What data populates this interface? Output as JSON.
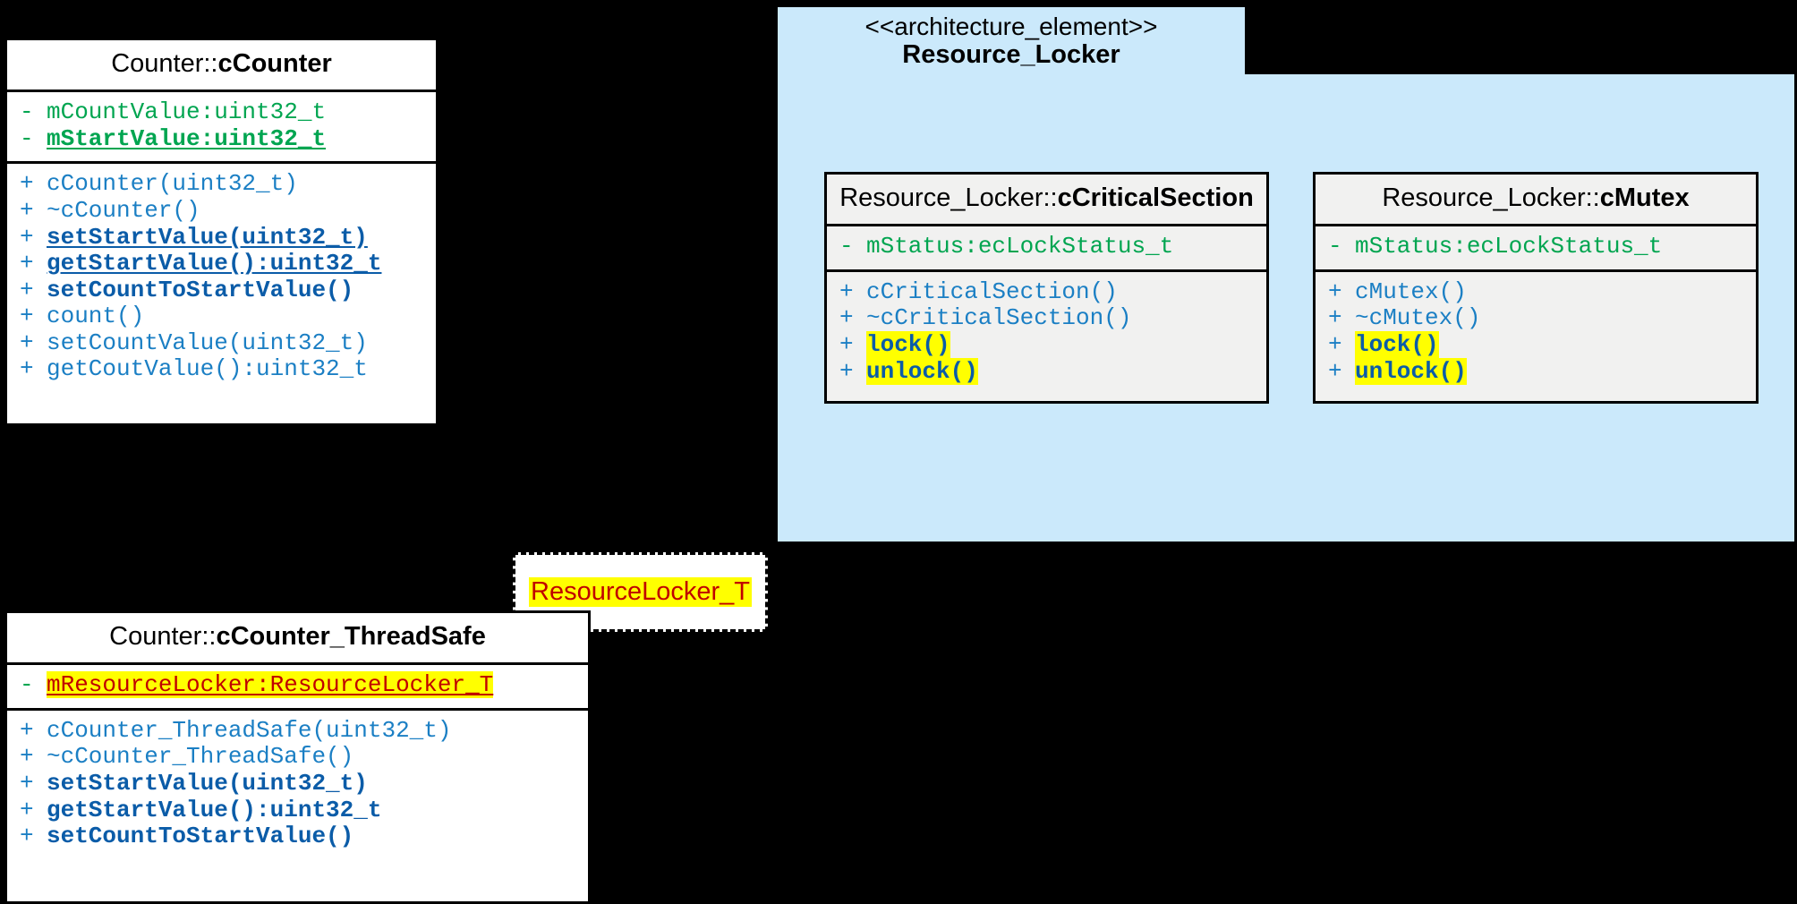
{
  "diagram": {
    "type": "uml-class-diagram",
    "background": "#000000",
    "colors": {
      "package_fill": "#cbe9fb",
      "class_fill_white": "#ffffff",
      "class_fill_gray": "#f1f1f0",
      "attribute_green": "#00a550",
      "method_blue": "#1b7fc4",
      "method_bold_blue": "#0b5ca8",
      "highlight_yellow": "#ffff00",
      "template_red": "#c00000",
      "border_black": "#000000"
    }
  },
  "counter_class": {
    "namespace": "Counter::",
    "name": "cCounter",
    "attributes": [
      {
        "visibility": "-",
        "text": "mCountValue:uint32_t",
        "bold": false,
        "underline": false
      },
      {
        "visibility": "-",
        "text": "mStartValue:uint32_t",
        "bold": true,
        "underline": true
      }
    ],
    "methods": [
      {
        "visibility": "+",
        "text": "cCounter(uint32_t)",
        "bold": false,
        "underline": false
      },
      {
        "visibility": "+",
        "text": "~cCounter()",
        "bold": false,
        "underline": false
      },
      {
        "visibility": "+",
        "text": "setStartValue(uint32_t)",
        "bold": true,
        "underline": true
      },
      {
        "visibility": "+",
        "text": "getStartValue():uint32_t",
        "bold": true,
        "underline": true
      },
      {
        "visibility": "+",
        "text": "setCountToStartValue()",
        "bold": true,
        "underline": false
      },
      {
        "visibility": "+",
        "text": "count()",
        "bold": false,
        "underline": false
      },
      {
        "visibility": "+",
        "text": "setCountValue(uint32_t)",
        "bold": false,
        "underline": false
      },
      {
        "visibility": "+",
        "text": "getCoutValue():uint32_t",
        "bold": false,
        "underline": false
      }
    ]
  },
  "resource_locker_package": {
    "stereotype": "<<architecture_element>>",
    "name": "Resource_Locker",
    "classes": [
      {
        "namespace": "Resource_Locker::",
        "name": "cCriticalSection",
        "attributes": [
          {
            "visibility": "-",
            "text": "mStatus:ecLockStatus_t",
            "bold": false,
            "underline": false
          }
        ],
        "methods": [
          {
            "visibility": "+",
            "text": "cCriticalSection()",
            "bold": false,
            "highlight": false
          },
          {
            "visibility": "+",
            "text": "~cCriticalSection()",
            "bold": false,
            "highlight": false
          },
          {
            "visibility": "+",
            "text": "lock()",
            "bold": true,
            "highlight": true
          },
          {
            "visibility": "+",
            "text": "unlock()",
            "bold": true,
            "highlight": true
          }
        ]
      },
      {
        "namespace": "Resource_Locker::",
        "name": "cMutex",
        "attributes": [
          {
            "visibility": "-",
            "text": "mStatus:ecLockStatus_t",
            "bold": false,
            "underline": false
          }
        ],
        "methods": [
          {
            "visibility": "+",
            "text": "cMutex()",
            "bold": false,
            "highlight": false
          },
          {
            "visibility": "+",
            "text": "~cMutex()",
            "bold": false,
            "highlight": false
          },
          {
            "visibility": "+",
            "text": "lock()",
            "bold": true,
            "highlight": true
          },
          {
            "visibility": "+",
            "text": "unlock()",
            "bold": true,
            "highlight": true
          }
        ]
      }
    ]
  },
  "template_parameter": {
    "label": "ResourceLocker_T"
  },
  "counter_threadsafe_class": {
    "namespace": "Counter::",
    "name": "cCounter_ThreadSafe",
    "attributes": [
      {
        "visibility": "-",
        "text": "mResourceLocker:ResourceLocker_T",
        "bold": false,
        "underline": true,
        "highlight": true
      }
    ],
    "methods": [
      {
        "visibility": "+",
        "text": "cCounter_ThreadSafe(uint32_t)",
        "bold": false
      },
      {
        "visibility": "+",
        "text": "~cCounter_ThreadSafe()",
        "bold": false
      },
      {
        "visibility": "+",
        "text": "setStartValue(uint32_t)",
        "bold": true
      },
      {
        "visibility": "+",
        "text": "getStartValue():uint32_t",
        "bold": true
      },
      {
        "visibility": "+",
        "text": "setCountToStartValue()",
        "bold": true
      }
    ]
  }
}
